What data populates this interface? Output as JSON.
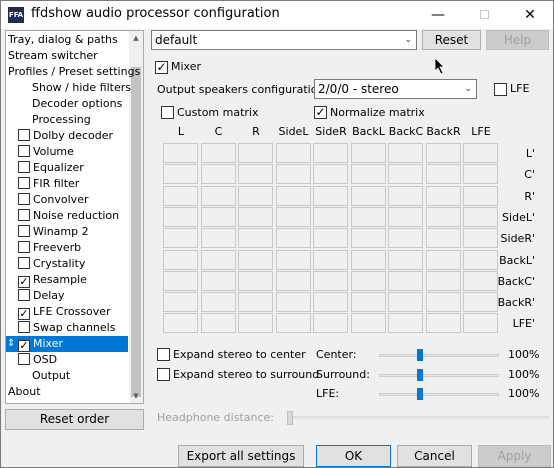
{
  "window": {
    "title": "ffdshow audio processor configuration",
    "app_icon_text": "FFA",
    "minimize": "—",
    "close": "✕"
  },
  "tree": {
    "items": [
      {
        "label": "Tray, dialog & paths",
        "indent": 0,
        "checkbox": null,
        "selected": false
      },
      {
        "label": "Stream switcher",
        "indent": 0,
        "checkbox": null,
        "selected": false
      },
      {
        "label": "Profiles / Preset settings",
        "indent": 0,
        "checkbox": null,
        "selected": false
      },
      {
        "label": "Show / hide filters",
        "indent": 2,
        "checkbox": null,
        "selected": false
      },
      {
        "label": "Decoder options",
        "indent": 2,
        "checkbox": null,
        "selected": false
      },
      {
        "label": "Processing",
        "indent": 2,
        "checkbox": null,
        "selected": false
      },
      {
        "label": "Dolby decoder",
        "indent": 1,
        "checkbox": false,
        "selected": false
      },
      {
        "label": "Volume",
        "indent": 1,
        "checkbox": false,
        "selected": false
      },
      {
        "label": "Equalizer",
        "indent": 1,
        "checkbox": false,
        "selected": false
      },
      {
        "label": "FIR filter",
        "indent": 1,
        "checkbox": false,
        "selected": false
      },
      {
        "label": "Convolver",
        "indent": 1,
        "checkbox": false,
        "selected": false
      },
      {
        "label": "Noise reduction",
        "indent": 1,
        "checkbox": false,
        "selected": false
      },
      {
        "label": "Winamp 2",
        "indent": 1,
        "checkbox": false,
        "selected": false
      },
      {
        "label": "Freeverb",
        "indent": 1,
        "checkbox": false,
        "selected": false
      },
      {
        "label": "Crystality",
        "indent": 1,
        "checkbox": false,
        "selected": false
      },
      {
        "label": "Resample",
        "indent": 1,
        "checkbox": true,
        "selected": false
      },
      {
        "label": "Delay",
        "indent": 1,
        "checkbox": false,
        "selected": false
      },
      {
        "label": "LFE Crossover",
        "indent": 1,
        "checkbox": true,
        "selected": false
      },
      {
        "label": "Swap channels",
        "indent": 1,
        "checkbox": false,
        "selected": false
      },
      {
        "label": "Mixer",
        "indent": 1,
        "checkbox": true,
        "selected": true
      },
      {
        "label": "OSD",
        "indent": 1,
        "checkbox": false,
        "selected": false
      },
      {
        "label": "Output",
        "indent": 2,
        "checkbox": null,
        "selected": false
      },
      {
        "label": "About",
        "indent": 0,
        "checkbox": null,
        "selected": false
      }
    ],
    "check_glyph": "✓",
    "updown_glyph": "⇕"
  },
  "reset_order_label": "Reset order",
  "preset": {
    "value": "default",
    "reset_label": "Reset",
    "help_label": "Help"
  },
  "mixer": {
    "enable_label": "Mixer",
    "enabled": true,
    "speakers_label": "Output speakers configuration:",
    "speakers_value": "2/0/0 - stereo",
    "lfe_label": "LFE",
    "custom_matrix_label": "Custom matrix",
    "normalize_label": "Normalize matrix",
    "normalize_checked": true,
    "columns": [
      "L",
      "C",
      "R",
      "SideL",
      "SideR",
      "BackL",
      "BackC",
      "BackR",
      "LFE"
    ],
    "rows": [
      "L'",
      "C'",
      "R'",
      "SideL'",
      "SideR'",
      "BackL'",
      "BackC'",
      "BackR'",
      "LFE'"
    ],
    "expand_center_label": "Expand stereo to center",
    "expand_surround_label": "Expand stereo to surround",
    "sliders": [
      {
        "label": "Center:",
        "value": "100%",
        "level": 1.0
      },
      {
        "label": "Surround:",
        "value": "100%",
        "level": 1.0
      },
      {
        "label": "LFE:",
        "value": "100%",
        "level": 1.0
      }
    ],
    "headphone_label": "Headphone distance:"
  },
  "footer": {
    "export_label": "Export all settings",
    "ok_label": "OK",
    "cancel_label": "Cancel",
    "apply_label": "Apply"
  }
}
